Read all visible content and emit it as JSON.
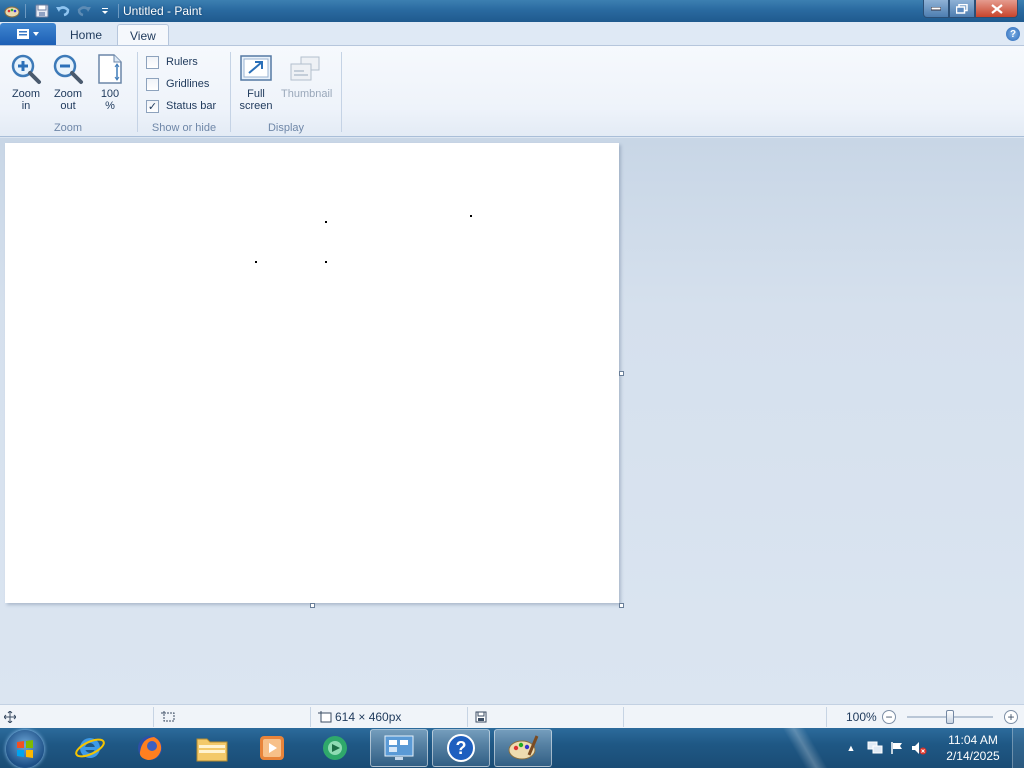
{
  "window": {
    "title": "Untitled - Paint"
  },
  "tabs": {
    "home": "Home",
    "view": "View"
  },
  "ribbon": {
    "zoom_group": {
      "label": "Zoom",
      "zoom_in": [
        "Zoom",
        "in"
      ],
      "zoom_out": [
        "Zoom",
        "out"
      ],
      "hundred": [
        "100",
        "%"
      ]
    },
    "show_hide_group": {
      "label": "Show or hide",
      "rulers": {
        "label": "Rulers",
        "checked": false
      },
      "gridlines": {
        "label": "Gridlines",
        "checked": false
      },
      "status_bar": {
        "label": "Status bar",
        "checked": true
      }
    },
    "display_group": {
      "label": "Display",
      "full_screen": [
        "Full",
        "screen"
      ],
      "thumbnail": "Thumbnail"
    }
  },
  "statusbar": {
    "canvas_size": "614 × 460px",
    "zoom_level": "100%",
    "zoom_fraction": 0.5
  },
  "taskbar": {
    "clock_time": "11:04 AM",
    "clock_date": "2/14/2025",
    "apps": [
      "internet-explorer-icon",
      "firefox-icon",
      "file-explorer-icon",
      "media-player-icon",
      "messenger-icon",
      "control-panel-icon",
      "help-icon",
      "paint-icon"
    ]
  },
  "colors": {
    "accent": "#1f5a8e",
    "ribbon_bg": "#eef3fa",
    "workspace_bg": "#d5e0ed"
  }
}
